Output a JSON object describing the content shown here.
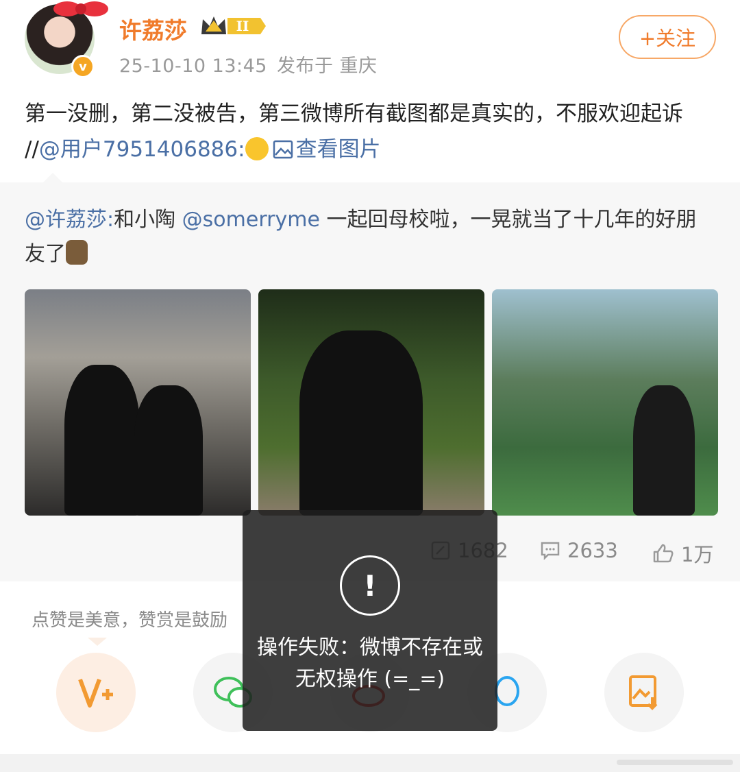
{
  "post": {
    "username": "许荔莎",
    "level_badge": "II",
    "verified_mark": "v",
    "timestamp": "25-10-10 13:45",
    "location": "发布于 重庆",
    "follow_label": "+关注",
    "text_main": "第一没删，第二没被告，第三微博所有截图都是真实的，不服欢迎起诉 //",
    "mention_user": "@用户7951406886:",
    "view_images": "查看图片"
  },
  "repost": {
    "author": "@许荔莎:",
    "text_a": "和小陶 ",
    "mention": "@somerryme",
    "text_b": " 一起回母校啦，一晃就当了十几年的好朋友了",
    "stats": {
      "reposts": "1682",
      "comments": "2633",
      "likes": "1万"
    }
  },
  "reward": {
    "label": "点赞是美意，赞赏是鼓励"
  },
  "toast": {
    "icon": "!",
    "message": "操作失败：微博不存在或无权操作 (=_=)"
  },
  "icons": {
    "repost": "repost-icon",
    "comment": "comment-icon",
    "like": "like-icon",
    "share": [
      "vplus-icon",
      "wechat-icon",
      "weibo-icon",
      "qq-icon",
      "save-image-icon"
    ]
  },
  "colors": {
    "username": "#f07b2b",
    "mention": "#4a6fa5",
    "toast_bg": "#1e1e1e"
  }
}
